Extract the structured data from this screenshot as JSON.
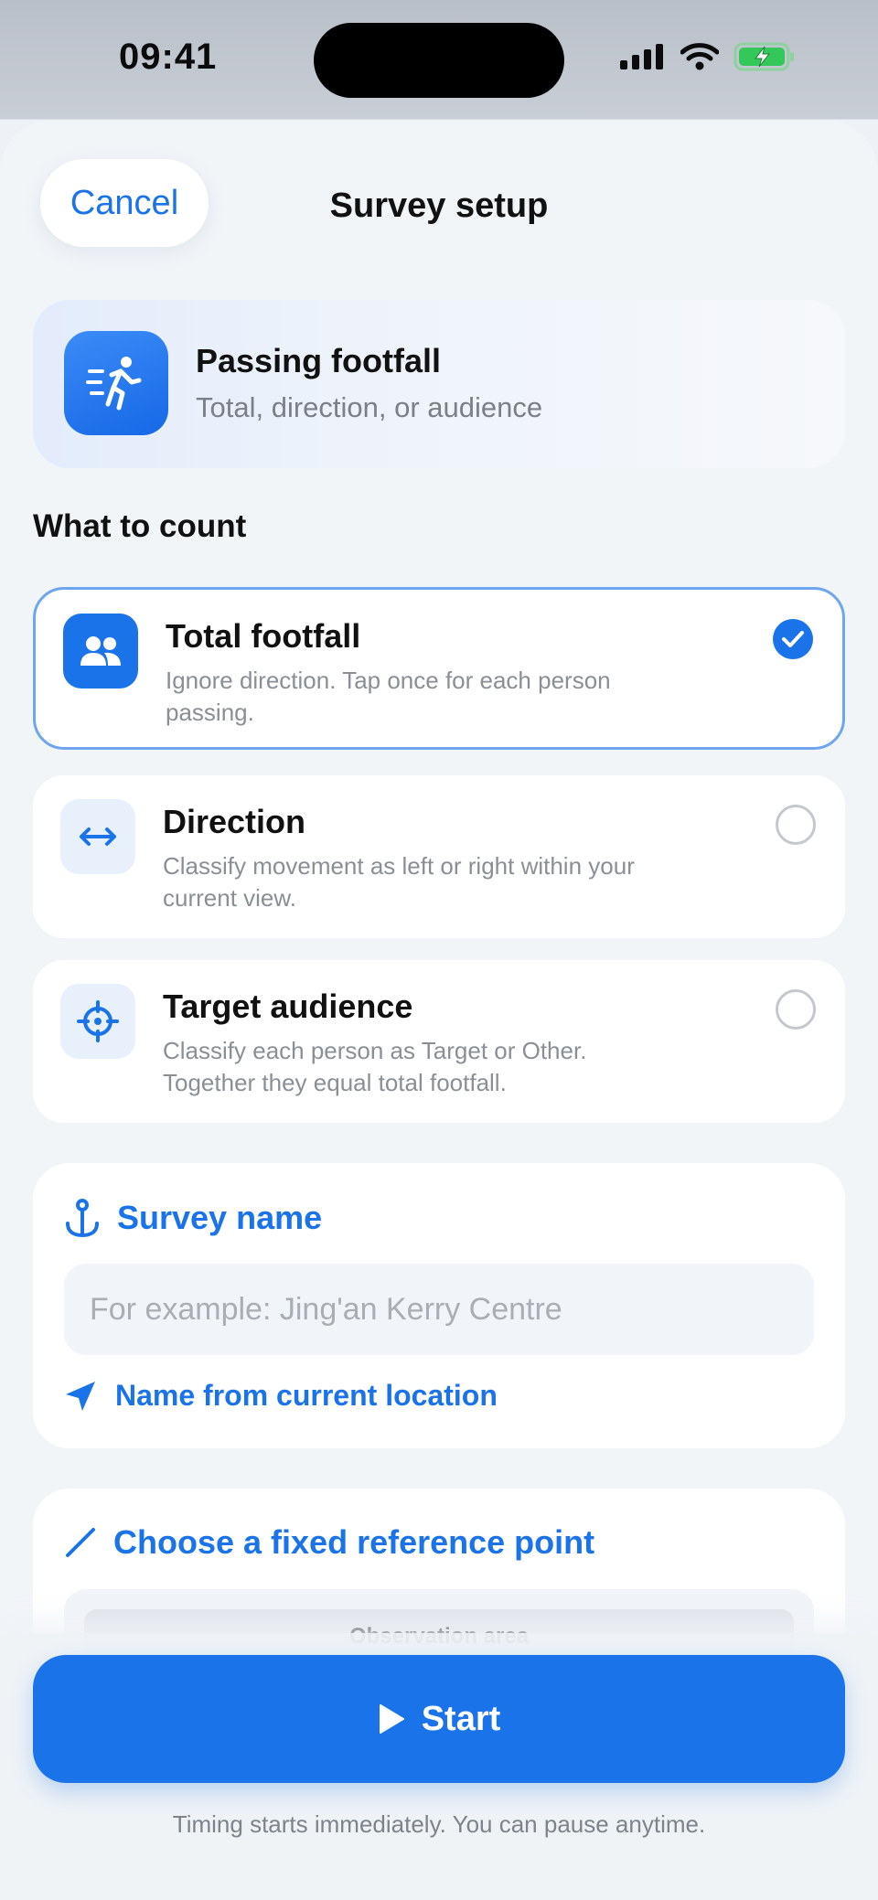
{
  "status_bar": {
    "time": "09:41"
  },
  "nav": {
    "cancel_label": "Cancel",
    "title": "Survey setup"
  },
  "mode": {
    "title": "Passing footfall",
    "subtitle": "Total, direction, or audience"
  },
  "count_section": {
    "label": "What to count",
    "options": [
      {
        "title": "Total footfall",
        "description": "Ignore direction. Tap once for each person passing.",
        "selected": true,
        "icon": "people-icon"
      },
      {
        "title": "Direction",
        "description": "Classify movement as left or right within your current view.",
        "selected": false,
        "icon": "left-right-arrows-icon"
      },
      {
        "title": "Target audience",
        "description": "Classify each person as Target or Other. Together they equal total footfall.",
        "selected": false,
        "icon": "crosshair-icon"
      }
    ]
  },
  "survey_name": {
    "heading": "Survey name",
    "placeholder": "For example: Jing'an Kerry Centre",
    "value": "",
    "location_link": "Name from current location"
  },
  "reference": {
    "heading": "Choose a fixed reference point",
    "tag": "Observation area"
  },
  "footer": {
    "start_label": "Start",
    "note": "Timing starts immediately. You can pause anytime."
  },
  "colors": {
    "accent": "#1a73e8",
    "background": "#f2f5f8",
    "selected_border": "#6ea6ee",
    "battery": "#34c759"
  }
}
